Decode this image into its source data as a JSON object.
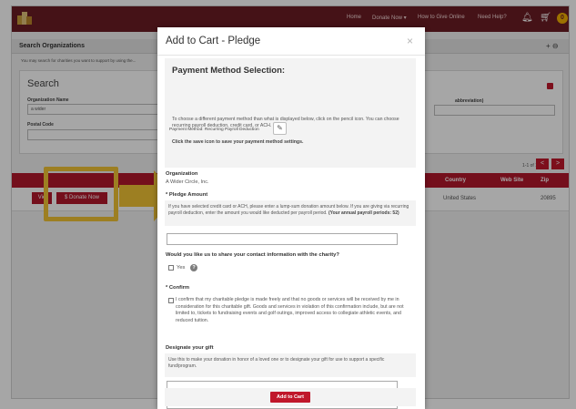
{
  "topnav": {
    "items": [
      "Home",
      "Donate Now ▾",
      "How to Give Online",
      "Need Help?"
    ],
    "icons": [
      "bell-icon",
      "cart-icon"
    ],
    "badge": "0"
  },
  "panel": {
    "title": "Search Organizations",
    "controls": "+ ⊖",
    "hint": "You may search for charities you want to support by using the...",
    "search_title": "Search",
    "org_name_label": "Organization Name",
    "org_name_value": "a wider",
    "postal_label": "Postal Code",
    "abbrev_label": "abbreviation)"
  },
  "results": {
    "pager": "1-1 of 1",
    "prev": "<",
    "next": ">",
    "columns": [
      "Country",
      "Web Site",
      "Zip"
    ],
    "row": {
      "country": "United States",
      "zip": "20895"
    },
    "view_label": "Vie",
    "donate_label": "$ Donate Now"
  },
  "modal": {
    "title": "Add to Cart - Pledge",
    "close": "×",
    "pay_heading": "Payment Method Selection:",
    "pay_text": "To choose a different payment method than what is displayed below, click on the pencil icon. You can choose recurring payroll deduction, credit card, or ACH.",
    "pay_save": "Click the save icon to save your payment method settings.",
    "pay_method": "Payment Method: Recurring Payroll Deduction",
    "org_label": "Organization",
    "org_value": "A Wider Circle, Inc.",
    "pledge_label": "* Pledge Amount",
    "pledge_text": "If you have selected credit card or ACH, please enter a lump-sum donation amount below. If you are giving via recurring payroll deduction, enter the amount you would like deducted per payroll period.",
    "pledge_bold": "(Your annual payroll periods: 52)",
    "share_label": "Would you like us to share your contact information with the charity?",
    "yes_label": "Yes",
    "help": "?",
    "confirm_label": "* Confirm",
    "confirm_text": "I confirm that my charitable pledge is made freely and that no goods or services will be received by me in consideration for this charitable gift. Goods and services in violation of this confirmation include, but are not limited to, tickets to fundraising events and golf outings, improved access to collegiate athletic events, and reduced tuition.",
    "designate_label": "Designate your gift",
    "designate_text": "Use this to make your donation in honor of a loved one or to designate your gift for use to support a specific fund/program.",
    "add_button": "Add to Cart"
  },
  "colors": {
    "topbar": "#6b1d24",
    "accent": "#c0172b",
    "highlight": "#f2c335"
  }
}
